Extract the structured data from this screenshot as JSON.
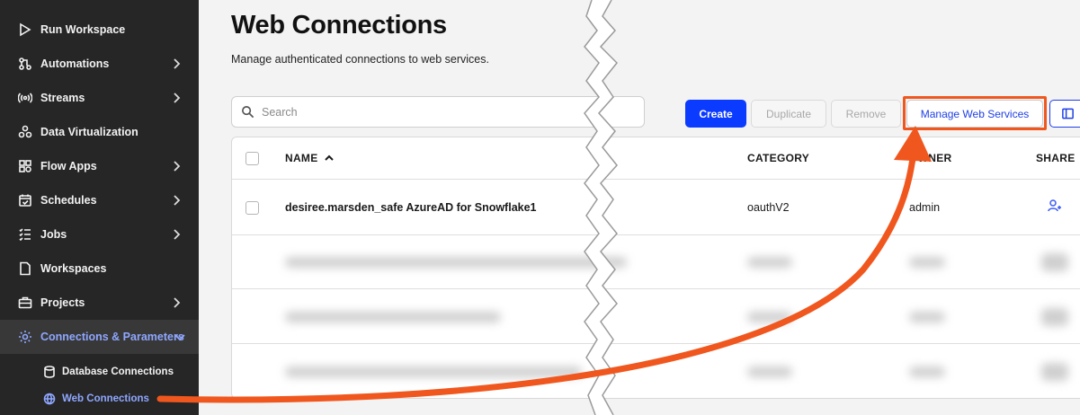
{
  "sidebar": {
    "items": [
      {
        "label": "Run Workspace",
        "icon": "play-icon",
        "chevron": false
      },
      {
        "label": "Automations",
        "icon": "automation-icon",
        "chevron": true
      },
      {
        "label": "Streams",
        "icon": "stream-icon",
        "chevron": true
      },
      {
        "label": "Data Virtualization",
        "icon": "data-virtualization-icon",
        "chevron": false
      },
      {
        "label": "Flow Apps",
        "icon": "apps-icon",
        "chevron": true
      },
      {
        "label": "Schedules",
        "icon": "calendar-icon",
        "chevron": true
      },
      {
        "label": "Jobs",
        "icon": "jobs-icon",
        "chevron": true
      },
      {
        "label": "Workspaces",
        "icon": "file-icon",
        "chevron": false
      },
      {
        "label": "Projects",
        "icon": "briefcase-icon",
        "chevron": true
      },
      {
        "label": "Connections & Parameters",
        "icon": "gear-icon",
        "chevron": true,
        "active": true
      }
    ],
    "sub_items": [
      {
        "label": "Database Connections",
        "icon": "database-icon"
      },
      {
        "label": "Web Connections",
        "icon": "globe-icon",
        "active": true
      }
    ]
  },
  "main": {
    "title": "Web Connections",
    "subtitle": "Manage authenticated connections to web services.",
    "search": {
      "placeholder": "Search"
    },
    "toolbar": {
      "create_label": "Create",
      "duplicate_label": "Duplicate",
      "remove_label": "Remove",
      "manage_label": "Manage Web Services"
    },
    "table": {
      "columns": [
        "NAME",
        "CATEGORY",
        "OWNER",
        "SHARE"
      ],
      "rows": [
        {
          "name": "desiree.marsden_safe AzureAD for Snowflake1",
          "category": "oauthV2",
          "owner": "admin"
        }
      ]
    }
  },
  "colors": {
    "accent": "#0b3bff",
    "highlight": "#f0571e",
    "sidebar_bg": "#262626",
    "active_nav": "#8fa7ff"
  }
}
